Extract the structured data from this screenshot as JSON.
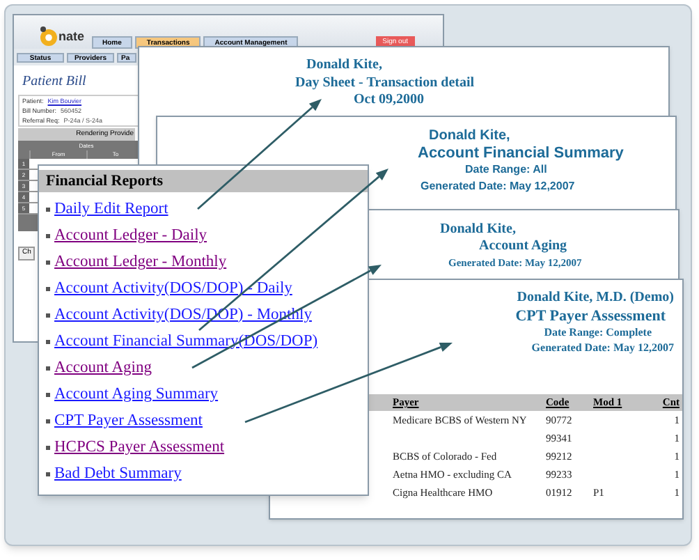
{
  "app_window": {
    "logo_text": "nate",
    "tabs": [
      {
        "label": "Home",
        "selected": false
      },
      {
        "label": "Transactions",
        "selected": true
      },
      {
        "label": "Account Management",
        "selected": false
      }
    ],
    "sign_out": "Sign out",
    "subtabs": [
      "Status",
      "Providers",
      "Pa"
    ],
    "title": "Patient Bill",
    "fields": [
      {
        "label": "Patient:",
        "value": "Kim Bouvier"
      },
      {
        "label": "Bill Number:",
        "value": "560452"
      },
      {
        "label": "Referral Req:",
        "value": "P-24a / S-24a"
      }
    ],
    "section": "Rendering Provide",
    "table": {
      "group": "Dates",
      "columns": [
        "From",
        "To"
      ],
      "row_numbers": [
        "1",
        "2",
        "3",
        "4",
        "5"
      ]
    },
    "button": "Ch"
  },
  "reports": [
    {
      "lines": [
        "Donald Kite,",
        "Day Sheet - Transaction detail",
        "Oct 09,2000"
      ]
    },
    {
      "lines": [
        "Donald Kite,",
        "Account Financial Summary",
        "Date Range: All",
        "Generated Date: May 12,2007"
      ]
    },
    {
      "lines": [
        "Donald Kite,",
        "Account Aging",
        "Generated Date: May 12,2007"
      ]
    },
    {
      "lines": [
        "Donald Kite, M.D. (Demo)",
        "CPT Payer Assessment",
        "Date Range: Complete",
        "Generated Date: May 12,2007"
      ]
    }
  ],
  "cpt_table": {
    "columns": [
      "Payer",
      "Code",
      "Mod 1",
      "Cnt"
    ],
    "rows": [
      [
        "Medicare BCBS of Western NY",
        "90772",
        "",
        "1"
      ],
      [
        "",
        "99341",
        "",
        "1"
      ],
      [
        "BCBS of Colorado - Fed",
        "99212",
        "",
        "1"
      ],
      [
        "Aetna HMO - excluding CA",
        "99233",
        "",
        "1"
      ],
      [
        "Cigna Healthcare HMO",
        "01912",
        "P1",
        "1"
      ]
    ]
  },
  "financial_reports": {
    "title": "Financial Reports",
    "items": [
      {
        "label": "Daily Edit Report",
        "visited": false
      },
      {
        "label": "Account Ledger - Daily",
        "visited": true
      },
      {
        "label": "Account Ledger - Monthly",
        "visited": true
      },
      {
        "label": "Account Activity(DOS/DOP) - Daily",
        "visited": false
      },
      {
        "label": "Account Activity(DOS/DOP) - Monthly",
        "visited": false
      },
      {
        "label": "Account Financial Summary(DOS/DOP)",
        "visited": false
      },
      {
        "label": "Account Aging",
        "visited": true
      },
      {
        "label": "Account Aging Summary",
        "visited": false
      },
      {
        "label": "CPT Payer Assessment",
        "visited": false
      },
      {
        "label": "HCPCS Payer Assessment",
        "visited": true
      },
      {
        "label": "Bad Debt Summary",
        "visited": false
      }
    ]
  }
}
